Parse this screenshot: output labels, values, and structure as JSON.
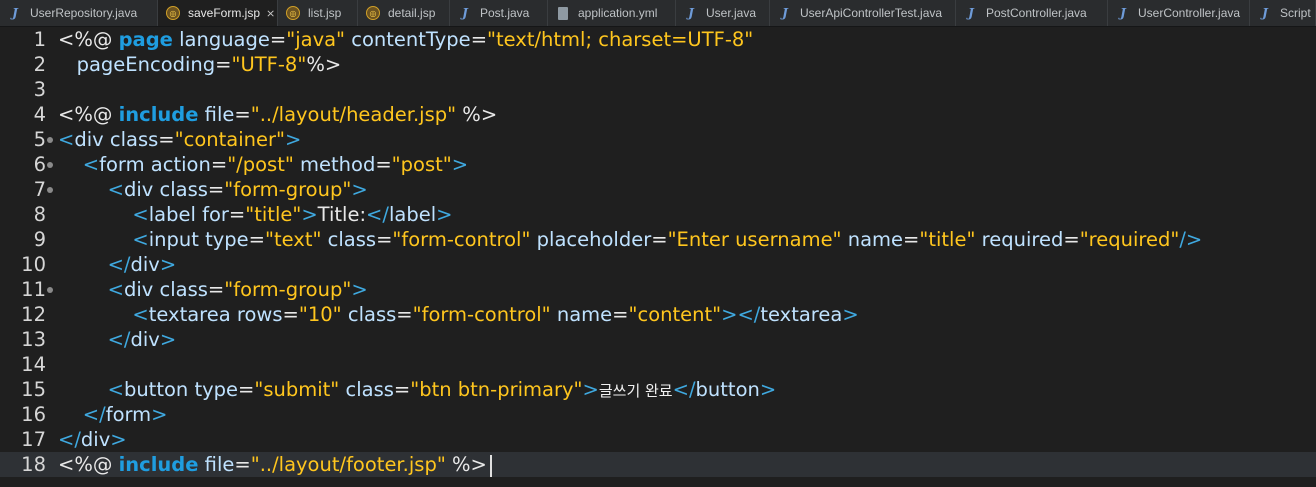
{
  "tabs": [
    {
      "label": "UserRepository.java",
      "icon": "java",
      "active": false
    },
    {
      "label": "saveForm.jsp",
      "icon": "jsp",
      "active": true,
      "close": "⨯"
    },
    {
      "label": "list.jsp",
      "icon": "jsp",
      "active": false
    },
    {
      "label": "detail.jsp",
      "icon": "jsp",
      "active": false
    },
    {
      "label": "Post.java",
      "icon": "java",
      "active": false
    },
    {
      "label": "application.yml",
      "icon": "file",
      "active": false
    },
    {
      "label": "User.java",
      "icon": "java",
      "active": false
    },
    {
      "label": "UserApiControllerTest.java",
      "icon": "java",
      "active": false
    },
    {
      "label": "PostController.java",
      "icon": "java",
      "active": false
    },
    {
      "label": "UserController.java",
      "icon": "java",
      "active": false
    },
    {
      "label": "Script",
      "icon": "java",
      "active": false
    }
  ],
  "editor": {
    "current_line": 18,
    "lines": [
      {
        "n": "1",
        "fold": false,
        "tokens": [
          [
            "d",
            "<%@ "
          ],
          [
            "k",
            "page"
          ],
          [
            "a",
            " language"
          ],
          [
            "d",
            "="
          ],
          [
            "v",
            "\"java\""
          ],
          [
            "a",
            " contentType"
          ],
          [
            "d",
            "="
          ],
          [
            "v",
            "\"text/html; charset=UTF-8\""
          ]
        ]
      },
      {
        "n": "2",
        "fold": false,
        "tokens": [
          [
            "a",
            "   pageEncoding"
          ],
          [
            "d",
            "="
          ],
          [
            "v",
            "\"UTF-8\""
          ],
          [
            "d",
            "%>"
          ]
        ]
      },
      {
        "n": "3",
        "fold": false,
        "tokens": []
      },
      {
        "n": "4",
        "fold": false,
        "tokens": [
          [
            "d",
            "<%@ "
          ],
          [
            "k",
            "include"
          ],
          [
            "a",
            " file"
          ],
          [
            "d",
            "="
          ],
          [
            "v",
            "\"../layout/header.jsp\""
          ],
          [
            "d",
            " %>"
          ]
        ]
      },
      {
        "n": "5",
        "fold": true,
        "tokens": [
          [
            "t",
            "<"
          ],
          [
            "a",
            "div"
          ],
          [
            "a",
            " class"
          ],
          [
            "d",
            "="
          ],
          [
            "v",
            "\"container\""
          ],
          [
            "t",
            ">"
          ]
        ]
      },
      {
        "n": "6",
        "fold": true,
        "tokens": [
          [
            "t",
            "    <"
          ],
          [
            "a",
            "form"
          ],
          [
            "a",
            " action"
          ],
          [
            "d",
            "="
          ],
          [
            "v",
            "\"/post\""
          ],
          [
            "a",
            " method"
          ],
          [
            "d",
            "="
          ],
          [
            "v",
            "\"post\""
          ],
          [
            "t",
            ">"
          ]
        ]
      },
      {
        "n": "7",
        "fold": true,
        "tokens": [
          [
            "t",
            "        <"
          ],
          [
            "a",
            "div"
          ],
          [
            "a",
            " class"
          ],
          [
            "d",
            "="
          ],
          [
            "v",
            "\"form-group\""
          ],
          [
            "t",
            ">"
          ]
        ]
      },
      {
        "n": "8",
        "fold": false,
        "tokens": [
          [
            "t",
            "            <"
          ],
          [
            "a",
            "label"
          ],
          [
            "a",
            " for"
          ],
          [
            "d",
            "="
          ],
          [
            "v",
            "\"title\""
          ],
          [
            "t",
            ">"
          ],
          [
            "d",
            "Title:"
          ],
          [
            "t",
            "</"
          ],
          [
            "a",
            "label"
          ],
          [
            "t",
            ">"
          ]
        ]
      },
      {
        "n": "9",
        "fold": false,
        "tokens": [
          [
            "t",
            "            <"
          ],
          [
            "a",
            "input"
          ],
          [
            "a",
            " type"
          ],
          [
            "d",
            "="
          ],
          [
            "v",
            "\"text\""
          ],
          [
            "a",
            " class"
          ],
          [
            "d",
            "="
          ],
          [
            "v",
            "\"form-control\""
          ],
          [
            "a",
            " placeholder"
          ],
          [
            "d",
            "="
          ],
          [
            "v",
            "\"Enter username\""
          ],
          [
            "a",
            " name"
          ],
          [
            "d",
            "="
          ],
          [
            "v",
            "\"title\""
          ],
          [
            "a",
            " required"
          ],
          [
            "d",
            "="
          ],
          [
            "v",
            "\"required\""
          ],
          [
            "t",
            "/>"
          ]
        ]
      },
      {
        "n": "10",
        "fold": false,
        "tokens": [
          [
            "t",
            "        </"
          ],
          [
            "a",
            "div"
          ],
          [
            "t",
            ">"
          ]
        ]
      },
      {
        "n": "11",
        "fold": true,
        "tokens": [
          [
            "t",
            "        <"
          ],
          [
            "a",
            "div"
          ],
          [
            "a",
            " class"
          ],
          [
            "d",
            "="
          ],
          [
            "v",
            "\"form-group\""
          ],
          [
            "t",
            ">"
          ]
        ]
      },
      {
        "n": "12",
        "fold": false,
        "tokens": [
          [
            "t",
            "            <"
          ],
          [
            "a",
            "textarea"
          ],
          [
            "a",
            " rows"
          ],
          [
            "d",
            "="
          ],
          [
            "v",
            "\"10\""
          ],
          [
            "a",
            " class"
          ],
          [
            "d",
            "="
          ],
          [
            "v",
            "\"form-control\""
          ],
          [
            "a",
            " name"
          ],
          [
            "d",
            "="
          ],
          [
            "v",
            "\"content\""
          ],
          [
            "t",
            "></"
          ],
          [
            "a",
            "textarea"
          ],
          [
            "t",
            ">"
          ]
        ]
      },
      {
        "n": "13",
        "fold": false,
        "tokens": [
          [
            "t",
            "        </"
          ],
          [
            "a",
            "div"
          ],
          [
            "t",
            ">"
          ]
        ]
      },
      {
        "n": "14",
        "fold": false,
        "tokens": []
      },
      {
        "n": "15",
        "fold": false,
        "tokens": [
          [
            "t",
            "        <"
          ],
          [
            "a",
            "button"
          ],
          [
            "a",
            " type"
          ],
          [
            "d",
            "="
          ],
          [
            "v",
            "\"submit\""
          ],
          [
            "a",
            " class"
          ],
          [
            "d",
            "="
          ],
          [
            "v",
            "\"btn btn-primary\""
          ],
          [
            "t",
            ">"
          ],
          [
            "x",
            "글쓰기 완료"
          ],
          [
            "t",
            "</"
          ],
          [
            "a",
            "button"
          ],
          [
            "t",
            ">"
          ]
        ]
      },
      {
        "n": "16",
        "fold": false,
        "tokens": [
          [
            "t",
            "    </"
          ],
          [
            "a",
            "form"
          ],
          [
            "t",
            ">"
          ]
        ]
      },
      {
        "n": "17",
        "fold": false,
        "tokens": [
          [
            "t",
            "</"
          ],
          [
            "a",
            "div"
          ],
          [
            "t",
            ">"
          ]
        ]
      },
      {
        "n": "18",
        "fold": false,
        "tokens": [
          [
            "d",
            "<%@ "
          ],
          [
            "k",
            "include"
          ],
          [
            "a",
            " file"
          ],
          [
            "d",
            "="
          ],
          [
            "v",
            "\"../layout/footer.jsp\""
          ],
          [
            "d",
            " %>"
          ]
        ]
      }
    ]
  }
}
